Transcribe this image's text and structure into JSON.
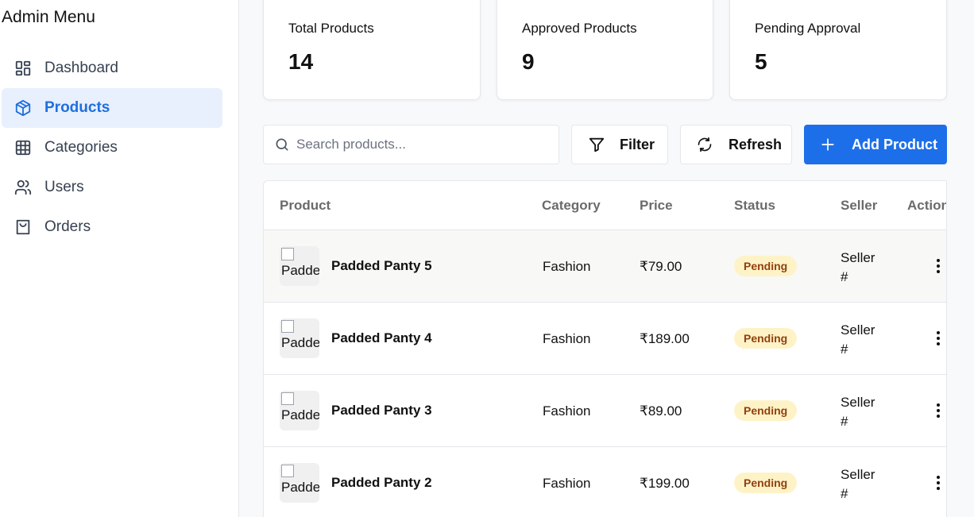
{
  "sidebar": {
    "title": "Admin Menu",
    "items": [
      {
        "label": "Dashboard",
        "icon": "dashboard-icon"
      },
      {
        "label": "Products",
        "icon": "box-icon",
        "active": true
      },
      {
        "label": "Categories",
        "icon": "grid-icon"
      },
      {
        "label": "Users",
        "icon": "users-icon"
      },
      {
        "label": "Orders",
        "icon": "shopping-bag-icon"
      }
    ]
  },
  "stats": [
    {
      "label": "Total Products",
      "value": "14"
    },
    {
      "label": "Approved Products",
      "value": "9"
    },
    {
      "label": "Pending Approval",
      "value": "5"
    }
  ],
  "toolbar": {
    "search_placeholder": "Search products...",
    "filter_label": "Filter",
    "refresh_label": "Refresh",
    "add_label": "Add Product"
  },
  "table": {
    "headers": [
      "Product",
      "Category",
      "Price",
      "Status",
      "Seller",
      "Actions"
    ],
    "rows": [
      {
        "image_alt": "Padded Panty 5",
        "name": "Padded Panty 5",
        "category": "Fashion",
        "price": "₹79.00",
        "status": "Pending",
        "seller_line1": "Seller",
        "seller_line2": "#"
      },
      {
        "image_alt": "Padded Panty 4",
        "name": "Padded Panty 4",
        "category": "Fashion",
        "price": "₹189.00",
        "status": "Pending",
        "seller_line1": "Seller",
        "seller_line2": "#"
      },
      {
        "image_alt": "Padded Panty 3",
        "name": "Padded Panty 3",
        "category": "Fashion",
        "price": "₹89.00",
        "status": "Pending",
        "seller_line1": "Seller",
        "seller_line2": "#"
      },
      {
        "image_alt": "Padded Panty 2",
        "name": "Padded Panty 2",
        "category": "Fashion",
        "price": "₹199.00",
        "status": "Pending",
        "seller_line1": "Seller",
        "seller_line2": "#"
      }
    ]
  },
  "colors": {
    "accent": "#1d6fe9",
    "active_bg": "#e8f0fe",
    "pending_bg": "#fef3c7",
    "pending_text": "#92400e"
  }
}
